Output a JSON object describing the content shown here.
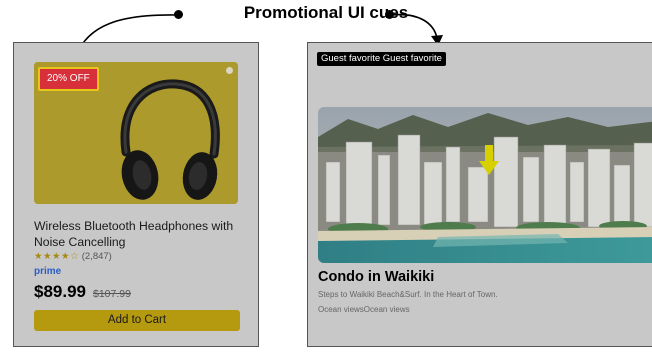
{
  "heading": "Promotional UI cues",
  "product": {
    "badge": "20% OFF",
    "title": "Wireless Bluetooth Headphones with Noise Cancelling",
    "stars": "★★★★☆",
    "rating_value": 4,
    "rating_count": "(2,847)",
    "prime": "prime",
    "price": "$89.99",
    "old_price": "$107.99",
    "add_to_cart": "Add to Cart"
  },
  "listing": {
    "badge": "Guest favorite Guest favorite",
    "title": "Condo in Waikiki",
    "description": "Steps to Waikiki Beach&Surf. In the Heart of Town.",
    "amenities": "Ocean viewsOcean views"
  },
  "colors": {
    "discount_badge": "#d8303a",
    "discount_border": "#e6c619",
    "cart_button": "#b59a10",
    "prime": "#2b5cc4",
    "highlight_arrow": "#d6d000"
  }
}
